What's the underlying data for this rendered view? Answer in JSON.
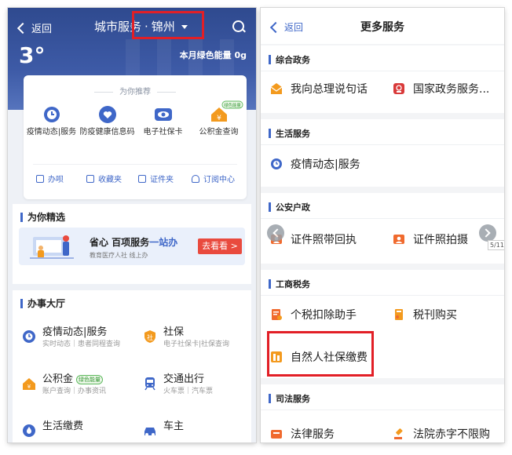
{
  "left": {
    "header": {
      "back_label": "返回",
      "title": "城市服务",
      "separator": "·",
      "city": "锦州",
      "temperature": "3°",
      "energy_label": "本月绿色能量",
      "energy_value": "0g"
    },
    "recommend": {
      "heading": "为你推荐",
      "items": [
        {
          "label": "疫情动态|服务",
          "icon": "clock-icon"
        },
        {
          "label": "防疫健康信息码",
          "icon": "heart-shield-icon"
        },
        {
          "label": "电子社保卡",
          "icon": "eye-card-icon"
        },
        {
          "label": "公积金查询",
          "icon": "house-yuan-icon",
          "badge": "绿色能量"
        }
      ],
      "shortcuts": [
        "办呗",
        "收藏夹",
        "证件夹",
        "订阅中心"
      ]
    },
    "featured": {
      "heading": "为你精选",
      "banner_title_a": "省心 百项服务",
      "banner_title_b": "一站办",
      "banner_sub": "教育医疗人社 线上办",
      "banner_button": "去看看 >"
    },
    "hall": {
      "heading": "办事大厅",
      "items": [
        {
          "title": "疫情动态|服务",
          "sub": "实时动态｜患者同程查询",
          "badge": ""
        },
        {
          "title": "社保",
          "sub": "电子社保卡|社保查询",
          "badge": ""
        },
        {
          "title": "公积金",
          "sub": "账户查询｜办事资讯",
          "badge": "绿色能量"
        },
        {
          "title": "交通出行",
          "sub": "火车票｜汽车票",
          "badge": ""
        },
        {
          "title": "生活缴费",
          "sub": "",
          "badge": ""
        },
        {
          "title": "车主",
          "sub": "",
          "badge": ""
        }
      ]
    }
  },
  "right": {
    "header": {
      "back_label": "返回",
      "title": "更多服务"
    },
    "sections": [
      {
        "heading": "综合政务",
        "items": [
          "我向总理说句话",
          "国家政务服务..."
        ]
      },
      {
        "heading": "生活服务",
        "items": [
          "疫情动态|服务"
        ]
      },
      {
        "heading": "公安户政",
        "items": [
          "证件照带回执",
          "证件照拍摄"
        ]
      },
      {
        "heading": "工商税务",
        "items": [
          "个税扣除助手",
          "税刊购买",
          "自然人社保缴费"
        ]
      },
      {
        "heading": "司法服务",
        "items": [
          "法律服务",
          "法院赤字不限购"
        ]
      }
    ],
    "pager": "5/11"
  },
  "colors": {
    "accent": "#3f67c8",
    "highlight": "#e21f26",
    "header_blue": "#2f4a8f",
    "orange": "#f39a1e"
  }
}
